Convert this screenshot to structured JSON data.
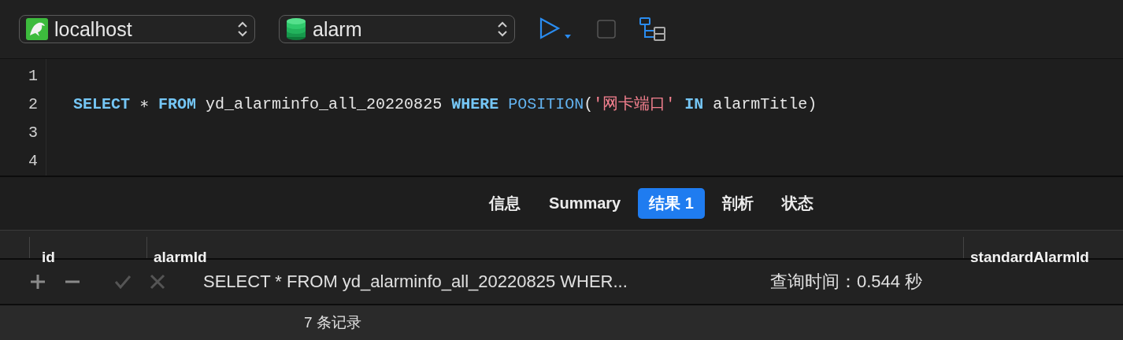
{
  "toolbar": {
    "connection": {
      "value": "localhost"
    },
    "database": {
      "value": "alarm"
    }
  },
  "editor": {
    "lines": [
      {
        "number": "1"
      },
      {
        "number": "2",
        "tokens": [
          {
            "kind": "keyword",
            "text": "SELECT"
          },
          {
            "kind": "plain",
            "text": " ∗ "
          },
          {
            "kind": "keyword",
            "text": "FROM"
          },
          {
            "kind": "plain",
            "text": " yd_alarminfo_all_20220825 "
          },
          {
            "kind": "keyword",
            "text": "WHERE"
          },
          {
            "kind": "function",
            "text": " POSITION"
          },
          {
            "kind": "plain",
            "text": "("
          },
          {
            "kind": "string",
            "text": "'网卡端口'"
          },
          {
            "kind": "keyword",
            "text": " IN"
          },
          {
            "kind": "plain",
            "text": " alarmTitle)"
          }
        ]
      },
      {
        "number": "3"
      },
      {
        "number": "4"
      }
    ]
  },
  "tabs": [
    {
      "label": "信息",
      "selected": false
    },
    {
      "label": "Summary",
      "selected": false
    },
    {
      "label": "结果 1",
      "selected": true
    },
    {
      "label": "剖析",
      "selected": false
    },
    {
      "label": "状态",
      "selected": false
    }
  ],
  "table": {
    "columns": [
      "id",
      "alarmId",
      "standardAlarmId"
    ]
  },
  "actions": [
    {
      "kind": "add",
      "disabled": false
    },
    {
      "kind": "remove",
      "disabled": false
    },
    {
      "kind": "apply",
      "disabled": true
    },
    {
      "kind": "discard",
      "disabled": true
    }
  ],
  "query_summary": "SELECT * FROM yd_alarminfo_all_20220825 WHER...",
  "query_time": "查询时间：0.544 秒",
  "status_bar": {
    "records": "7 条记录"
  }
}
